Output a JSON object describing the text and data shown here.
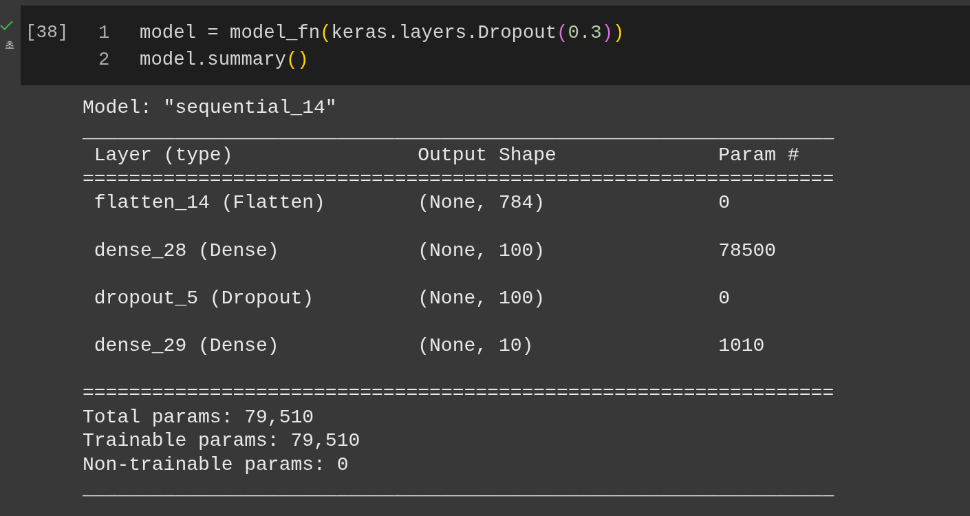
{
  "cell": {
    "succeeded": true,
    "duration": "초",
    "execution_count": "[38]",
    "lines": [
      {
        "number": "1",
        "tokens": [
          {
            "kind": "plain",
            "text": "model = model_fn"
          },
          {
            "kind": "bracket1",
            "text": "("
          },
          {
            "kind": "plain",
            "text": "keras.layers.Dropout"
          },
          {
            "kind": "bracket2",
            "text": "("
          },
          {
            "kind": "number",
            "text": "0.3"
          },
          {
            "kind": "bracket2",
            "text": ")"
          },
          {
            "kind": "bracket1",
            "text": ")"
          }
        ]
      },
      {
        "number": "2",
        "tokens": [
          {
            "kind": "plain",
            "text": "model.summary"
          },
          {
            "kind": "bracket1",
            "text": "()"
          }
        ]
      }
    ]
  },
  "output": {
    "model_line": "Model: \"sequential_14\"",
    "rule_top": "_________________________________________________________________",
    "columns": [
      "Layer (type)",
      "Output Shape",
      "Param #"
    ],
    "rule_header": "=================================================================",
    "rows": [
      {
        "layer": "flatten_14 (Flatten)",
        "output_shape": "(None, 784)",
        "param": "0"
      },
      {
        "layer": "dense_28 (Dense)",
        "output_shape": "(None, 100)",
        "param": "78500"
      },
      {
        "layer": "dropout_5 (Dropout)",
        "output_shape": "(None, 100)",
        "param": "0"
      },
      {
        "layer": "dense_29 (Dense)",
        "output_shape": "(None, 10)",
        "param": "1010"
      }
    ],
    "rule_bottom": "=================================================================",
    "totals": [
      "Total params: 79,510",
      "Trainable params: 79,510",
      "Non-trainable params: 0"
    ],
    "rule_end": "_________________________________________________________________"
  }
}
